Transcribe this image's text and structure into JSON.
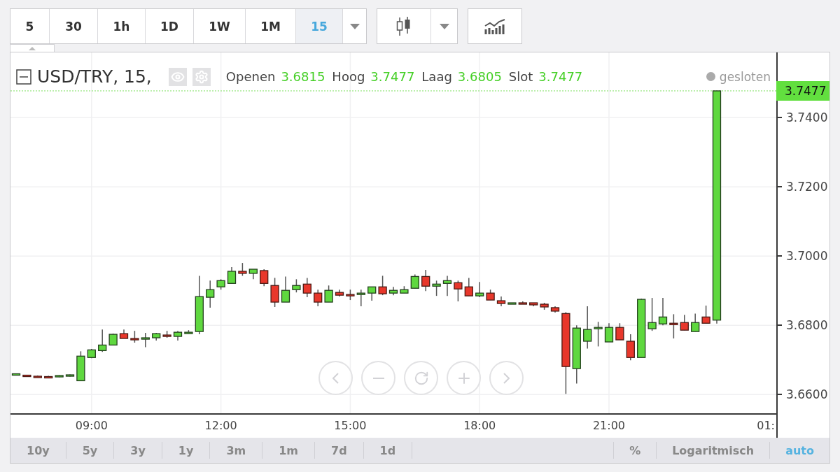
{
  "toolbar": {
    "intervals": [
      {
        "label": "5",
        "selected": false
      },
      {
        "label": "30",
        "selected": false
      },
      {
        "label": "1h",
        "selected": false
      },
      {
        "label": "1D",
        "selected": false
      },
      {
        "label": "1W",
        "selected": false
      },
      {
        "label": "1M",
        "selected": false
      },
      {
        "label": "15",
        "selected": true
      }
    ]
  },
  "chart": {
    "symbol": "USD/TRY, 15,",
    "ohlc": [
      {
        "label": "Openen",
        "value": "3.6815"
      },
      {
        "label": "Hoog",
        "value": "3.7477"
      },
      {
        "label": "Laag",
        "value": "3.6805"
      },
      {
        "label": "Slot",
        "value": "3.7477"
      }
    ],
    "status": "gesloten",
    "last_price": "3.7477",
    "cut_time_label": "01:",
    "chart_data": {
      "type": "candlestick",
      "grid": true,
      "ref_lines": [
        {
          "axis": "y",
          "value": 3.7477
        }
      ],
      "ylim": [
        3.6546,
        3.7588
      ],
      "xlim": [
        7.12,
        24.88
      ],
      "yticks": [
        {
          "value": 3.66,
          "label": "3.6600"
        },
        {
          "value": 3.68,
          "label": "3.6800"
        },
        {
          "value": 3.7,
          "label": "3.7000"
        },
        {
          "value": 3.72,
          "label": "3.7200"
        },
        {
          "value": 3.74,
          "label": "3.7400"
        }
      ],
      "xticks": [
        {
          "value": 9,
          "label": "09:00"
        },
        {
          "value": 12,
          "label": "12:00"
        },
        {
          "value": 15,
          "label": "15:00"
        },
        {
          "value": 18,
          "label": "18:00"
        },
        {
          "value": 21,
          "label": "21:00"
        }
      ],
      "x": [
        7.25,
        7.5,
        7.75,
        8,
        8.25,
        8.5,
        8.75,
        9,
        9.25,
        9.5,
        9.75,
        10,
        10.25,
        10.5,
        10.75,
        11,
        11.25,
        11.5,
        11.75,
        12,
        12.25,
        12.5,
        12.75,
        13,
        13.25,
        13.5,
        13.75,
        14,
        14.25,
        14.5,
        14.75,
        15,
        15.25,
        15.5,
        15.75,
        16,
        16.25,
        16.5,
        16.75,
        17,
        17.25,
        17.5,
        17.75,
        18,
        18.25,
        18.5,
        18.75,
        19,
        19.25,
        19.5,
        19.75,
        20,
        20.25,
        20.5,
        20.75,
        21,
        21.25,
        21.5,
        21.75,
        22,
        22.25,
        22.5,
        22.75,
        23,
        23.25,
        23.5
      ],
      "ohlc": [
        [
          3.6658,
          3.6661,
          3.6657,
          3.666
        ],
        [
          3.6656,
          3.6657,
          3.6652,
          3.6653
        ],
        [
          3.6653,
          3.6655,
          3.6651,
          3.6652
        ],
        [
          3.6652,
          3.6654,
          3.665,
          3.6651
        ],
        [
          3.6651,
          3.6656,
          3.665,
          3.6655
        ],
        [
          3.6655,
          3.6658,
          3.6652,
          3.6657
        ],
        [
          3.664,
          3.6725,
          3.664,
          3.6711
        ],
        [
          3.6707,
          3.6732,
          3.6705,
          3.6729
        ],
        [
          3.6727,
          3.6788,
          3.6723,
          3.6743
        ],
        [
          3.6743,
          3.6776,
          3.6743,
          3.6774
        ],
        [
          3.6776,
          3.6788,
          3.6762,
          3.6762
        ],
        [
          3.6762,
          3.6784,
          3.675,
          3.6758
        ],
        [
          3.676,
          3.6778,
          3.6737,
          3.6764
        ],
        [
          3.6764,
          3.6778,
          3.6756,
          3.6776
        ],
        [
          3.6772,
          3.6784,
          3.6764,
          3.6768
        ],
        [
          3.6768,
          3.6784,
          3.6756,
          3.678
        ],
        [
          3.6778,
          3.6786,
          3.6776,
          3.678
        ],
        [
          3.6782,
          3.6943,
          3.6774,
          3.6883
        ],
        [
          3.6881,
          3.6929,
          3.6851,
          3.6903
        ],
        [
          3.6911,
          3.6933,
          3.6903,
          3.6929
        ],
        [
          3.6921,
          3.6968,
          3.6921,
          3.6956
        ],
        [
          3.6956,
          3.698,
          3.6943,
          3.695
        ],
        [
          3.695,
          3.6962,
          3.6933,
          3.6962
        ],
        [
          3.6958,
          3.6962,
          3.6913,
          3.6921
        ],
        [
          3.6915,
          3.6937,
          3.6853,
          3.6867
        ],
        [
          3.6867,
          3.6941,
          3.6867,
          3.6901
        ],
        [
          3.6903,
          3.6933,
          3.6895,
          3.6915
        ],
        [
          3.6919,
          3.6937,
          3.6881,
          3.6893
        ],
        [
          3.6893,
          3.6903,
          3.6855,
          3.6867
        ],
        [
          3.6867,
          3.6915,
          3.6867,
          3.6901
        ],
        [
          3.6895,
          3.6903,
          3.6883,
          3.6887
        ],
        [
          3.6889,
          3.6903,
          3.6873,
          3.6885
        ],
        [
          3.6889,
          3.6903,
          3.6855,
          3.6893
        ],
        [
          3.6893,
          3.6911,
          3.6871,
          3.6911
        ],
        [
          3.6911,
          3.6943,
          3.6887,
          3.6891
        ],
        [
          3.6893,
          3.6911,
          3.6887,
          3.6901
        ],
        [
          3.6893,
          3.6913,
          3.6893,
          3.6903
        ],
        [
          3.6907,
          3.6947,
          3.6907,
          3.6941
        ],
        [
          3.6941,
          3.696,
          3.6899,
          3.6913
        ],
        [
          3.6913,
          3.6929,
          3.6885,
          3.6919
        ],
        [
          3.6921,
          3.6943,
          3.6885,
          3.6929
        ],
        [
          3.6923,
          3.6929,
          3.6869,
          3.6905
        ],
        [
          3.6911,
          3.6937,
          3.6885,
          3.6885
        ],
        [
          3.6885,
          3.6925,
          3.6881,
          3.6893
        ],
        [
          3.6893,
          3.6903,
          3.6873,
          3.6873
        ],
        [
          3.6871,
          3.6883,
          3.6855,
          3.6863
        ],
        [
          3.6863,
          3.6865,
          3.6861,
          3.6865
        ],
        [
          3.6865,
          3.6869,
          3.6863,
          3.6863
        ],
        [
          3.6865,
          3.6865,
          3.6855,
          3.6859
        ],
        [
          3.6861,
          3.6865,
          3.6845,
          3.6853
        ],
        [
          3.6851,
          3.6855,
          3.6837,
          3.6841
        ],
        [
          3.6834,
          3.6838,
          3.6602,
          3.6681
        ],
        [
          3.6675,
          3.68,
          3.6632,
          3.6792
        ],
        [
          3.6754,
          3.6855,
          3.6733,
          3.6788
        ],
        [
          3.679,
          3.681,
          3.6739,
          3.6794
        ],
        [
          3.6752,
          3.6806,
          3.6752,
          3.6794
        ],
        [
          3.6794,
          3.6806,
          3.6758,
          3.6758
        ],
        [
          3.6754,
          3.6774,
          3.6699,
          3.6707
        ],
        [
          3.6707,
          3.6877,
          3.6707,
          3.6875
        ],
        [
          3.679,
          3.6879,
          3.6784,
          3.6808
        ],
        [
          3.6804,
          3.6879,
          3.68,
          3.6824
        ],
        [
          3.6806,
          3.6832,
          3.6762,
          3.6802
        ],
        [
          3.6808,
          3.683,
          3.6786,
          3.6786
        ],
        [
          3.6782,
          3.6834,
          3.6782,
          3.6808
        ],
        [
          3.6824,
          3.6857,
          3.6806,
          3.6806
        ],
        [
          3.6815,
          3.7477,
          3.6805,
          3.7477
        ]
      ]
    }
  },
  "ranges": [
    "10y",
    "5y",
    "3y",
    "1y",
    "3m",
    "1m",
    "7d",
    "1d"
  ],
  "scale_options": [
    {
      "label": "%",
      "selected": false
    },
    {
      "label": "Logaritmisch",
      "selected": false
    },
    {
      "label": "auto",
      "selected": true
    }
  ]
}
